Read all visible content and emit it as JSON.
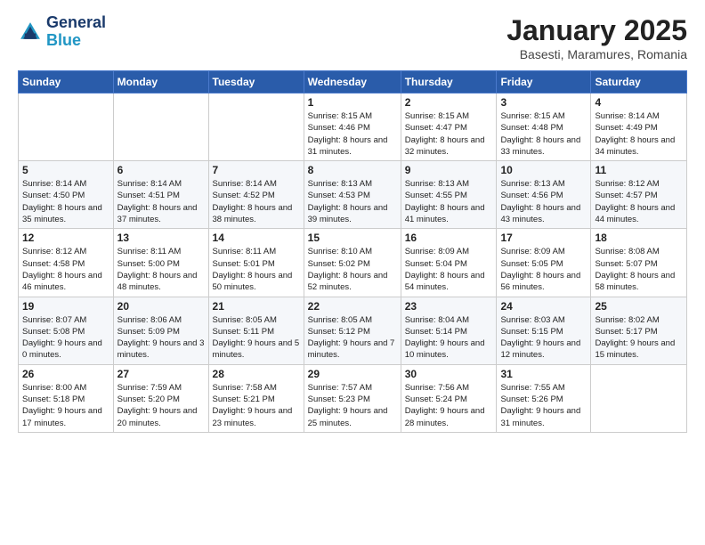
{
  "header": {
    "logo_line1": "General",
    "logo_line2": "Blue",
    "month": "January 2025",
    "location": "Basesti, Maramures, Romania"
  },
  "weekdays": [
    "Sunday",
    "Monday",
    "Tuesday",
    "Wednesday",
    "Thursday",
    "Friday",
    "Saturday"
  ],
  "weeks": [
    [
      {
        "day": "",
        "info": ""
      },
      {
        "day": "",
        "info": ""
      },
      {
        "day": "",
        "info": ""
      },
      {
        "day": "1",
        "info": "Sunrise: 8:15 AM\nSunset: 4:46 PM\nDaylight: 8 hours\nand 31 minutes."
      },
      {
        "day": "2",
        "info": "Sunrise: 8:15 AM\nSunset: 4:47 PM\nDaylight: 8 hours\nand 32 minutes."
      },
      {
        "day": "3",
        "info": "Sunrise: 8:15 AM\nSunset: 4:48 PM\nDaylight: 8 hours\nand 33 minutes."
      },
      {
        "day": "4",
        "info": "Sunrise: 8:14 AM\nSunset: 4:49 PM\nDaylight: 8 hours\nand 34 minutes."
      }
    ],
    [
      {
        "day": "5",
        "info": "Sunrise: 8:14 AM\nSunset: 4:50 PM\nDaylight: 8 hours\nand 35 minutes."
      },
      {
        "day": "6",
        "info": "Sunrise: 8:14 AM\nSunset: 4:51 PM\nDaylight: 8 hours\nand 37 minutes."
      },
      {
        "day": "7",
        "info": "Sunrise: 8:14 AM\nSunset: 4:52 PM\nDaylight: 8 hours\nand 38 minutes."
      },
      {
        "day": "8",
        "info": "Sunrise: 8:13 AM\nSunset: 4:53 PM\nDaylight: 8 hours\nand 39 minutes."
      },
      {
        "day": "9",
        "info": "Sunrise: 8:13 AM\nSunset: 4:55 PM\nDaylight: 8 hours\nand 41 minutes."
      },
      {
        "day": "10",
        "info": "Sunrise: 8:13 AM\nSunset: 4:56 PM\nDaylight: 8 hours\nand 43 minutes."
      },
      {
        "day": "11",
        "info": "Sunrise: 8:12 AM\nSunset: 4:57 PM\nDaylight: 8 hours\nand 44 minutes."
      }
    ],
    [
      {
        "day": "12",
        "info": "Sunrise: 8:12 AM\nSunset: 4:58 PM\nDaylight: 8 hours\nand 46 minutes."
      },
      {
        "day": "13",
        "info": "Sunrise: 8:11 AM\nSunset: 5:00 PM\nDaylight: 8 hours\nand 48 minutes."
      },
      {
        "day": "14",
        "info": "Sunrise: 8:11 AM\nSunset: 5:01 PM\nDaylight: 8 hours\nand 50 minutes."
      },
      {
        "day": "15",
        "info": "Sunrise: 8:10 AM\nSunset: 5:02 PM\nDaylight: 8 hours\nand 52 minutes."
      },
      {
        "day": "16",
        "info": "Sunrise: 8:09 AM\nSunset: 5:04 PM\nDaylight: 8 hours\nand 54 minutes."
      },
      {
        "day": "17",
        "info": "Sunrise: 8:09 AM\nSunset: 5:05 PM\nDaylight: 8 hours\nand 56 minutes."
      },
      {
        "day": "18",
        "info": "Sunrise: 8:08 AM\nSunset: 5:07 PM\nDaylight: 8 hours\nand 58 minutes."
      }
    ],
    [
      {
        "day": "19",
        "info": "Sunrise: 8:07 AM\nSunset: 5:08 PM\nDaylight: 9 hours\nand 0 minutes."
      },
      {
        "day": "20",
        "info": "Sunrise: 8:06 AM\nSunset: 5:09 PM\nDaylight: 9 hours\nand 3 minutes."
      },
      {
        "day": "21",
        "info": "Sunrise: 8:05 AM\nSunset: 5:11 PM\nDaylight: 9 hours\nand 5 minutes."
      },
      {
        "day": "22",
        "info": "Sunrise: 8:05 AM\nSunset: 5:12 PM\nDaylight: 9 hours\nand 7 minutes."
      },
      {
        "day": "23",
        "info": "Sunrise: 8:04 AM\nSunset: 5:14 PM\nDaylight: 9 hours\nand 10 minutes."
      },
      {
        "day": "24",
        "info": "Sunrise: 8:03 AM\nSunset: 5:15 PM\nDaylight: 9 hours\nand 12 minutes."
      },
      {
        "day": "25",
        "info": "Sunrise: 8:02 AM\nSunset: 5:17 PM\nDaylight: 9 hours\nand 15 minutes."
      }
    ],
    [
      {
        "day": "26",
        "info": "Sunrise: 8:00 AM\nSunset: 5:18 PM\nDaylight: 9 hours\nand 17 minutes."
      },
      {
        "day": "27",
        "info": "Sunrise: 7:59 AM\nSunset: 5:20 PM\nDaylight: 9 hours\nand 20 minutes."
      },
      {
        "day": "28",
        "info": "Sunrise: 7:58 AM\nSunset: 5:21 PM\nDaylight: 9 hours\nand 23 minutes."
      },
      {
        "day": "29",
        "info": "Sunrise: 7:57 AM\nSunset: 5:23 PM\nDaylight: 9 hours\nand 25 minutes."
      },
      {
        "day": "30",
        "info": "Sunrise: 7:56 AM\nSunset: 5:24 PM\nDaylight: 9 hours\nand 28 minutes."
      },
      {
        "day": "31",
        "info": "Sunrise: 7:55 AM\nSunset: 5:26 PM\nDaylight: 9 hours\nand 31 minutes."
      },
      {
        "day": "",
        "info": ""
      }
    ]
  ]
}
